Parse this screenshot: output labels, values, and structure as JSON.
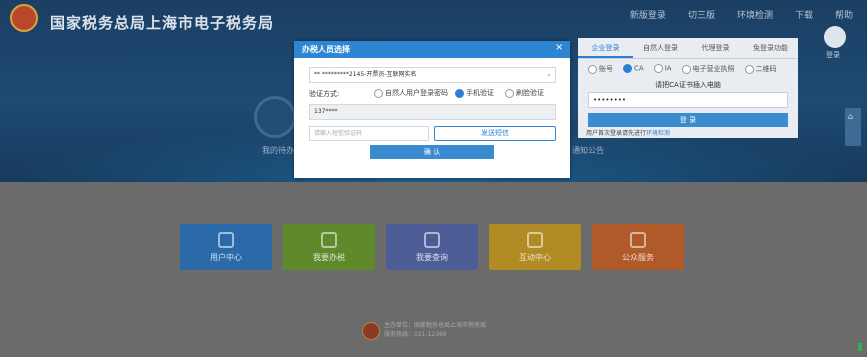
{
  "header": {
    "site_title": "国家税务总局上海市电子税务局",
    "top_links": [
      "新版登录",
      "切三版",
      "环境检测",
      "下载",
      "帮助"
    ],
    "avatar_label": "登录"
  },
  "background": {
    "left_text": "我的待办",
    "right_text": "通知公告"
  },
  "login_panel": {
    "tabs": [
      {
        "label": "企业登录",
        "active": true
      },
      {
        "label": "自然人登录",
        "active": false
      },
      {
        "label": "代理登录",
        "active": false
      },
      {
        "label": "免登录功能",
        "active": false
      }
    ],
    "methods": [
      {
        "label": "账号",
        "selected": false
      },
      {
        "label": "CA",
        "selected": true
      },
      {
        "label": "IA",
        "selected": false
      },
      {
        "label": "电子营业执照",
        "selected": false
      },
      {
        "label": "二维码",
        "selected": false
      }
    ],
    "prompt": "请把CA证书插入电脑",
    "password_value": "••••••••",
    "login_button": "登 录",
    "note_prefix": "用户首次登录请先进行",
    "note_link": "环境检测"
  },
  "modal": {
    "title": "办税人员选择",
    "close_symbol": "×",
    "person_select_value": "**         *********2145-开票员-互联网实名",
    "verify_label": "验证方式:",
    "verify_options": [
      {
        "label": "自然人用户登录密码",
        "selected": false
      },
      {
        "label": "手机验证",
        "selected": true
      },
      {
        "label": "刷脸验证",
        "selected": false
      }
    ],
    "phone_value": "137****",
    "code_placeholder": "请输入短信验证码",
    "send_button": "发送短信",
    "confirm_button": "确 认"
  },
  "tiles": [
    {
      "label": "用户中心",
      "color": "#2b6aa8"
    },
    {
      "label": "我要办税",
      "color": "#5f8a2b"
    },
    {
      "label": "我要查询",
      "color": "#4c5d97"
    },
    {
      "label": "互动中心",
      "color": "#b08a22"
    },
    {
      "label": "公众服务",
      "color": "#b05a2a"
    }
  ],
  "footer": {
    "line1": "主办单位：国家税务总局上海市税务局",
    "line2": "服务热线：021-12366"
  }
}
